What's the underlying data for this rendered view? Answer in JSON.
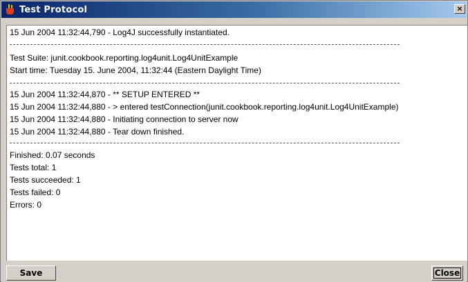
{
  "window": {
    "title": "Test Protocol",
    "close_glyph": "×"
  },
  "log": {
    "lines": [
      "15 Jun 2004 11:32:44,790 - Log4J successfully instantiated.",
      "Test Suite: junit.cookbook.reporting.log4unit.Log4UnitExample",
      "Start time: Tuesday 15. June 2004, 11:32:44 (Eastern Daylight Time)",
      "15 Jun 2004 11:32:44,870 - ** SETUP ENTERED **",
      "15 Jun 2004 11:32:44,880 - > entered testConnection(junit.cookbook.reporting.log4unit.Log4UnitExample)",
      "15 Jun 2004 11:32:44,880 - Initiating connection to server now",
      "15 Jun 2004 11:32:44,880 - Tear down finished.",
      "Finished: 0.07 seconds",
      "Tests total: 1",
      "Tests succeeded: 1",
      "Tests failed: 0",
      "Errors: 0"
    ]
  },
  "buttons": {
    "save_label": "Save",
    "close_label": "Close"
  }
}
